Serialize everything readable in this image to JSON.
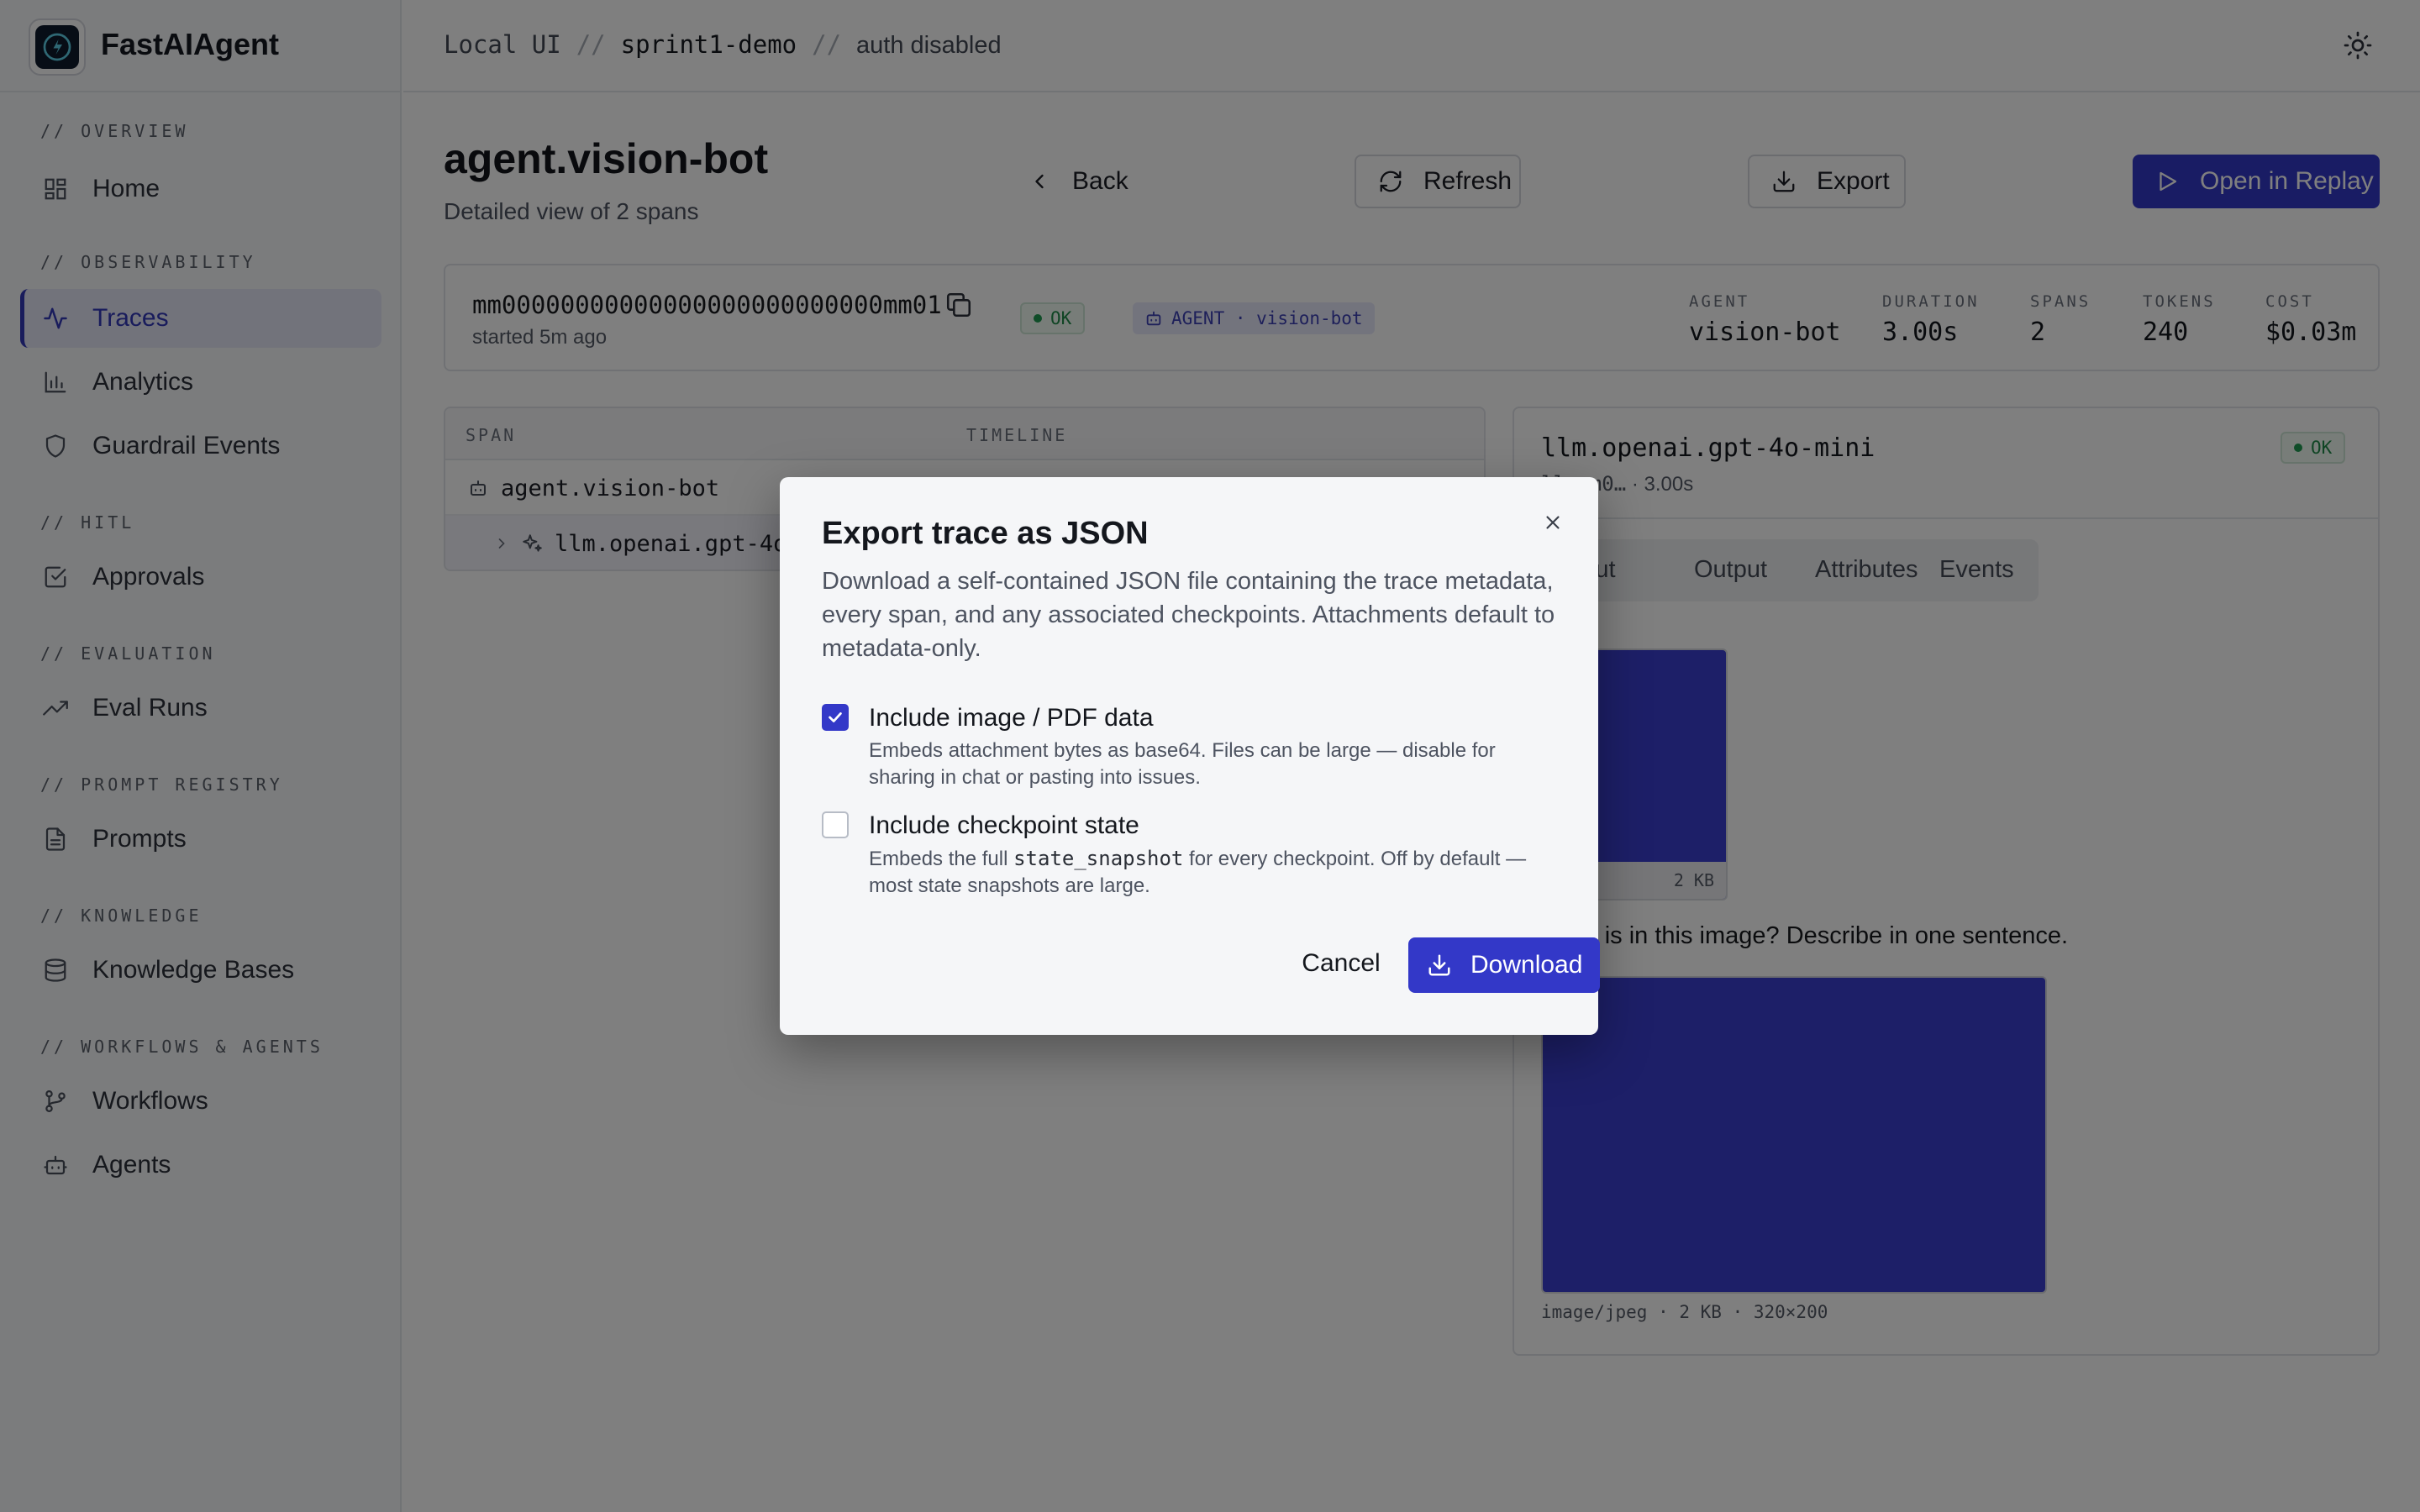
{
  "brand": {
    "name": "FastAIAgent"
  },
  "breadcrumb": {
    "item1": "Local UI",
    "sep": "//",
    "item2": "sprint1-demo",
    "item3": "auth disabled"
  },
  "sidebar": {
    "sections": [
      {
        "label": "// OVERVIEW",
        "items": [
          {
            "label": "Home",
            "icon": "grid-icon"
          }
        ]
      },
      {
        "label": "// OBSERVABILITY",
        "items": [
          {
            "label": "Traces",
            "icon": "activity-icon",
            "active": true
          },
          {
            "label": "Analytics",
            "icon": "bar-chart-icon"
          },
          {
            "label": "Guardrail Events",
            "icon": "shield-icon"
          }
        ]
      },
      {
        "label": "// HITL",
        "items": [
          {
            "label": "Approvals",
            "icon": "check-square-icon"
          }
        ]
      },
      {
        "label": "// EVALUATION",
        "items": [
          {
            "label": "Eval Runs",
            "icon": "trending-up-icon"
          }
        ]
      },
      {
        "label": "// PROMPT REGISTRY",
        "items": [
          {
            "label": "Prompts",
            "icon": "file-text-icon"
          }
        ]
      },
      {
        "label": "// KNOWLEDGE",
        "items": [
          {
            "label": "Knowledge Bases",
            "icon": "database-icon"
          }
        ]
      },
      {
        "label": "// WORKFLOWS & AGENTS",
        "items": [
          {
            "label": "Workflows",
            "icon": "git-branch-icon"
          },
          {
            "label": "Agents",
            "icon": "bot-icon"
          }
        ]
      }
    ]
  },
  "page": {
    "title": "agent.vision-bot",
    "subtitle": "Detailed view of 2 spans",
    "actions": {
      "back": "Back",
      "refresh": "Refresh",
      "export": "Export",
      "replay": "Open in Replay"
    }
  },
  "summary": {
    "trace_id": "mm00000000000000000000000000mm01",
    "started": "started 5m ago",
    "status": "OK",
    "agent_tag": "AGENT · vision-bot",
    "stats": [
      {
        "label": "AGENT",
        "value": "vision-bot"
      },
      {
        "label": "DURATION",
        "value": "3.00s"
      },
      {
        "label": "SPANS",
        "value": "2"
      },
      {
        "label": "TOKENS",
        "value": "240"
      },
      {
        "label": "COST",
        "value": "$0.03m"
      }
    ]
  },
  "spans": {
    "columns": {
      "span": "SPAN",
      "timeline": "TIMELINE"
    },
    "rows": [
      {
        "label": "agent.vision-bot"
      },
      {
        "label": "llm.openai.gpt-4o-mini"
      }
    ]
  },
  "detail": {
    "title": "llm.openai.gpt-4o-mini",
    "meta_id": "llm.m0…",
    "meta_duration": "3.00s",
    "status": "OK",
    "tabs": {
      "input": "Input",
      "output": "Output",
      "attributes": "Attributes",
      "events": "Events"
    },
    "image1_caption": "2 KB",
    "prompt": "What is in this image? Describe in one sentence.",
    "image2_caption": "image/jpeg · 2 KB · 320×200"
  },
  "modal": {
    "title": "Export trace as JSON",
    "description": "Download a self-contained JSON file containing the trace metadata, every span, and any associated checkpoints. Attachments default to metadata-only.",
    "option1": {
      "label": "Include image / PDF data",
      "checked": true,
      "help": "Embeds attachment bytes as base64. Files can be large — disable for sharing in chat or pasting into issues."
    },
    "option2": {
      "label": "Include checkpoint state",
      "checked": false,
      "help_pre": "Embeds the full ",
      "help_code": "state_snapshot",
      "help_post": " for every checkpoint. Off by default — most state snapshots are large."
    },
    "cancel": "Cancel",
    "download": "Download"
  },
  "colors": {
    "accent": "#3338c8",
    "ok": "#1f8a48",
    "overlay": "rgba(0,0,0,0.5)"
  }
}
